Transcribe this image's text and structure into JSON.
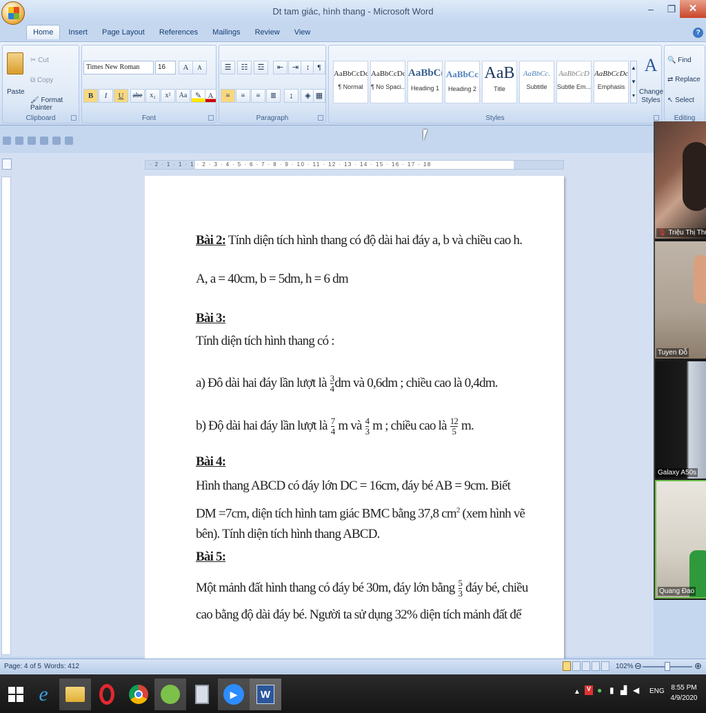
{
  "window": {
    "title": "Dt tam giác, hình thang - Microsoft Word"
  },
  "tabs": [
    "Home",
    "Insert",
    "Page Layout",
    "References",
    "Mailings",
    "Review",
    "View"
  ],
  "clipboard": {
    "group": "Clipboard",
    "paste": "Paste",
    "cut": "Cut",
    "copy": "Copy",
    "format_painter": "Format Painter"
  },
  "font": {
    "group": "Font",
    "family": "Times New Roman",
    "size": "16",
    "bold": "B",
    "italic": "I",
    "underline": "U",
    "strike": "abe",
    "sub": "x₂",
    "sup": "x²",
    "case": "Aa",
    "grow": "A",
    "shrink": "A"
  },
  "paragraph": {
    "group": "Paragraph"
  },
  "styles": {
    "group": "Styles",
    "items": [
      {
        "sample": "AaBbCcDc",
        "name": "¶ Normal"
      },
      {
        "sample": "AaBbCcDc",
        "name": "¶ No Spaci..."
      },
      {
        "sample": "AaBbC(",
        "name": "Heading 1"
      },
      {
        "sample": "AaBbCc",
        "name": "Heading 2"
      },
      {
        "sample": "AaB",
        "name": "Title"
      },
      {
        "sample": "AaBbCc.",
        "name": "Subtitle"
      },
      {
        "sample": "AaBbCcD",
        "name": "Subtle Em..."
      },
      {
        "sample": "AaBbCcDc",
        "name": "Emphasis"
      }
    ],
    "change": "Change Styles"
  },
  "editing": {
    "group": "Editing",
    "find": "Find",
    "replace": "Replace",
    "select": "Select"
  },
  "ruler": {
    "h_ticks": "· 2 · 1 · 1 · 1 · 2 · 3 · 4 · 5 · 6 · 7 · 8 · 9 · 10 · 11 · 12 · 13 · 14 · 15 · 16 · 17 · 18"
  },
  "doc": {
    "bai2_label": "Bài 2:",
    "bai2_text": " Tính diện tích hình thang có độ dài hai đáy a, b và chiều cao h.",
    "bai2_a": "A, a = 40cm, b = 5dm, h = 6 dm",
    "bai3_label": "Bài 3:",
    "bai3_text": "Tính diện tích hình thang có :",
    "bai3_a_pre": "a) Đô dài hai đáy lần lượt là ",
    "bai3_a_f1n": "3",
    "bai3_a_f1d": "4",
    "bai3_a_post": "dm và 0,6dm ; chiều cao là 0,4dm.",
    "bai3_b_pre": "b) Độ dài hai đáy lần lượt là ",
    "bai3_b_f1n": "7",
    "bai3_b_f1d": "4",
    "bai3_b_mid1": " m và ",
    "bai3_b_f2n": "4",
    "bai3_b_f2d": "3",
    "bai3_b_mid2": " m ; chiều cao là ",
    "bai3_b_f3n": "12",
    "bai3_b_f3d": "5",
    "bai3_b_post": " m.",
    "bai4_label": "Bài 4:",
    "bai4_l1": "Hình thang ABCD có đáy lớn DC = 16cm, đáy bé AB = 9cm. Biết",
    "bai4_l2a": "DM =7cm, diện tích hình tam giác BMC bằng 37,8 cm",
    "bai4_l2sup": "2",
    "bai4_l2b": " (xem hình vẽ",
    "bai4_l3": "bên). Tính diện tích hình thang ABCD.",
    "bai5_label": "Bài 5:",
    "bai5_l1a": "Một mảnh đất hình thang có đáy bé 30m, đáy lớn bằng ",
    "bai5_f_n": "5",
    "bai5_f_d": "3",
    "bai5_l1b": " đáy bé, chiều",
    "bai5_l2": "cao bằng độ dài đáy bé. Người ta sử dụng 32% diện tích mảnh đất để"
  },
  "video": [
    {
      "name": "Triệu Thị Thùy"
    },
    {
      "name": "Tuyen Đỗ"
    },
    {
      "name": "Galaxy A50s"
    },
    {
      "name": "Quang Đao"
    }
  ],
  "status": {
    "page": "Page: 4 of 5",
    "words": "Words: 412",
    "zoom": "102%"
  },
  "taskbar": {
    "time": "8:55 PM",
    "date": "4/9/2020",
    "lang": "ENG"
  },
  "colors": {
    "ribbon": "#dbe7f7",
    "taskbar": "#1e1e1e",
    "accent": "#2b579a"
  }
}
